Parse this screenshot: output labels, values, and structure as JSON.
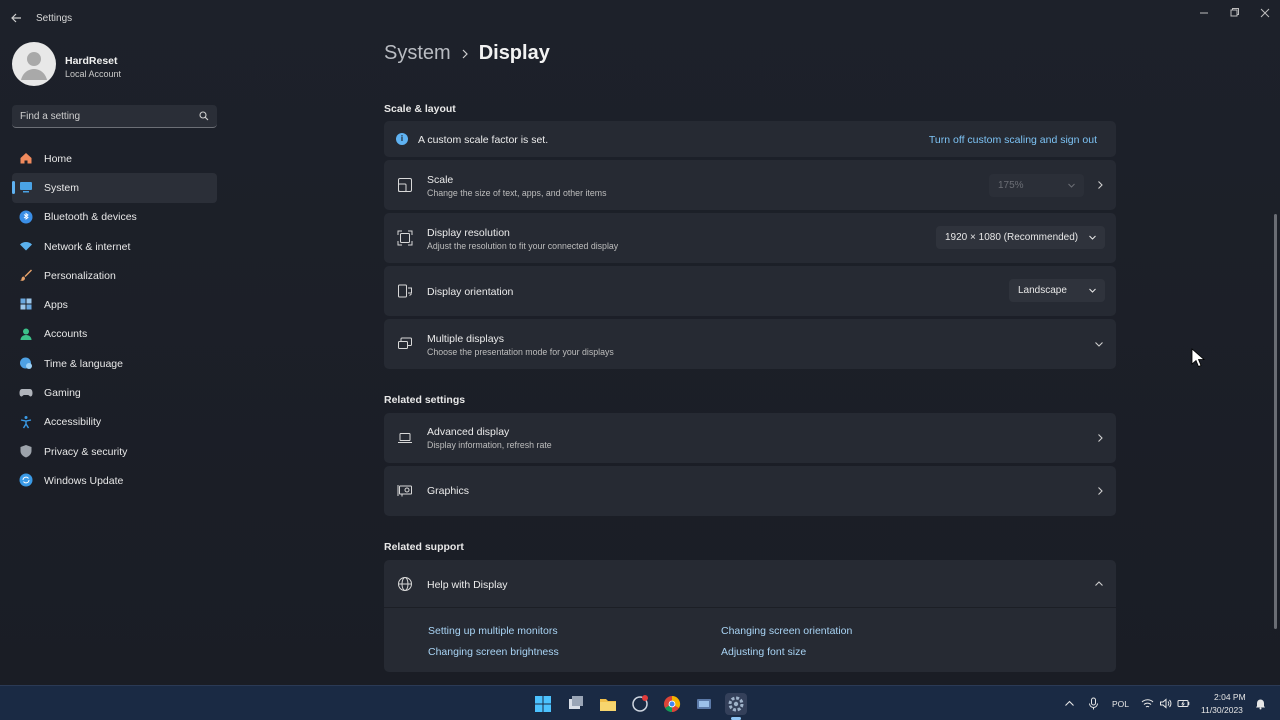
{
  "window": {
    "title": "Settings"
  },
  "profile": {
    "name": "HardReset",
    "account_type": "Local Account"
  },
  "search": {
    "placeholder": "Find a setting"
  },
  "sidebar": {
    "items": [
      {
        "label": "Home",
        "icon": "home-icon",
        "color": "#f08a5d"
      },
      {
        "label": "System",
        "icon": "monitor-icon",
        "color": "#4aa3e6",
        "active": true
      },
      {
        "label": "Bluetooth & devices",
        "icon": "bluetooth-icon",
        "color": "#3a8ee6"
      },
      {
        "label": "Network & internet",
        "icon": "wifi-icon",
        "color": "#5ab0ec"
      },
      {
        "label": "Personalization",
        "icon": "brush-icon",
        "color": "#e8a26a"
      },
      {
        "label": "Apps",
        "icon": "apps-icon",
        "color": "#6aa7de"
      },
      {
        "label": "Accounts",
        "icon": "person-icon",
        "color": "#3cc28a"
      },
      {
        "label": "Time & language",
        "icon": "globe-clock-icon",
        "color": "#4ea1e4"
      },
      {
        "label": "Gaming",
        "icon": "controller-icon",
        "color": "#b0b4bb"
      },
      {
        "label": "Accessibility",
        "icon": "accessibility-icon",
        "color": "#3a9ae6"
      },
      {
        "label": "Privacy & security",
        "icon": "shield-icon",
        "color": "#9da3ab"
      },
      {
        "label": "Windows Update",
        "icon": "update-icon",
        "color": "#3a9ae6"
      }
    ]
  },
  "breadcrumb": {
    "parent": "System",
    "current": "Display"
  },
  "scale_layout": {
    "heading": "Scale & layout",
    "banner": {
      "text": "A custom scale factor is set.",
      "link": "Turn off custom scaling and sign out"
    },
    "scale": {
      "title": "Scale",
      "sub": "Change the size of text, apps, and other items",
      "value": "175%"
    },
    "resolution": {
      "title": "Display resolution",
      "sub": "Adjust the resolution to fit your connected display",
      "value": "1920 × 1080 (Recommended)"
    },
    "orientation": {
      "title": "Display orientation",
      "value": "Landscape"
    },
    "multiple": {
      "title": "Multiple displays",
      "sub": "Choose the presentation mode for your displays"
    }
  },
  "related_settings": {
    "heading": "Related settings",
    "advanced": {
      "title": "Advanced display",
      "sub": "Display information, refresh rate"
    },
    "graphics": {
      "title": "Graphics"
    }
  },
  "related_support": {
    "heading": "Related support",
    "help": {
      "title": "Help with Display",
      "links": [
        "Setting up multiple monitors",
        "Changing screen orientation",
        "Changing screen brightness",
        "Adjusting font size"
      ]
    }
  },
  "taskbar": {
    "apps": [
      "windows-start-icon",
      "task-view-icon",
      "file-explorer-icon",
      "app-icon",
      "chrome-icon",
      "app-icon-2",
      "settings-icon"
    ],
    "language": "POL",
    "time": "2:04 PM",
    "date": "11/30/2023"
  }
}
